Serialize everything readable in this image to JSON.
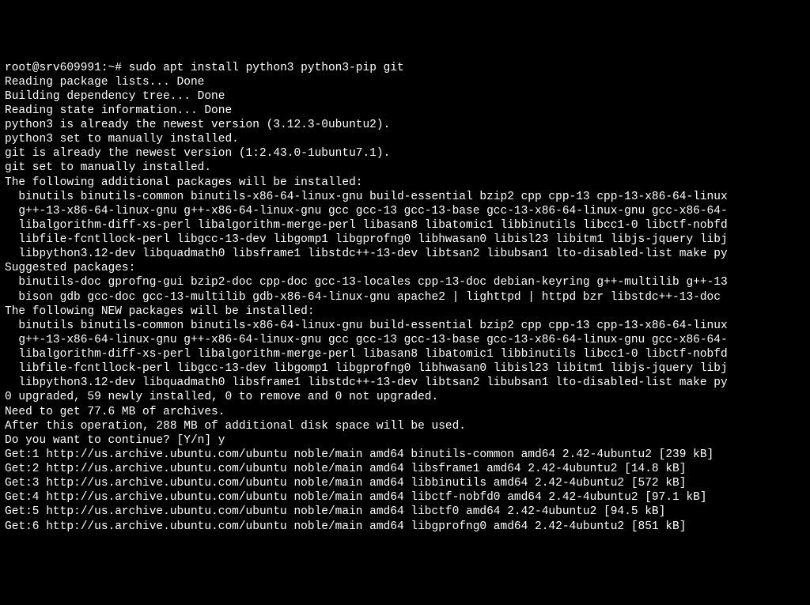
{
  "prompt": {
    "user_host": "root@srv609991",
    "cwd": "~",
    "symbol": "#",
    "command": "sudo apt install python3 python3-pip git"
  },
  "lines": [
    "Reading package lists... Done",
    "Building dependency tree... Done",
    "Reading state information... Done",
    "python3 is already the newest version (3.12.3-0ubuntu2).",
    "python3 set to manually installed.",
    "git is already the newest version (1:2.43.0-1ubuntu7.1).",
    "git set to manually installed.",
    "The following additional packages will be installed:",
    "  binutils binutils-common binutils-x86-64-linux-gnu build-essential bzip2 cpp cpp-13 cpp-13-x86-64-linux",
    "  g++-13-x86-64-linux-gnu g++-x86-64-linux-gnu gcc gcc-13 gcc-13-base gcc-13-x86-64-linux-gnu gcc-x86-64-",
    "  libalgorithm-diff-xs-perl libalgorithm-merge-perl libasan8 libatomic1 libbinutils libcc1-0 libctf-nobfd",
    "  libfile-fcntllock-perl libgcc-13-dev libgomp1 libgprofng0 libhwasan0 libisl23 libitm1 libjs-jquery libj",
    "  libpython3.12-dev libquadmath0 libsframe1 libstdc++-13-dev libtsan2 libubsan1 lto-disabled-list make py",
    "Suggested packages:",
    "  binutils-doc gprofng-gui bzip2-doc cpp-doc gcc-13-locales cpp-13-doc debian-keyring g++-multilib g++-13",
    "  bison gdb gcc-doc gcc-13-multilib gdb-x86-64-linux-gnu apache2 | lighttpd | httpd bzr libstdc++-13-doc ",
    "The following NEW packages will be installed:",
    "  binutils binutils-common binutils-x86-64-linux-gnu build-essential bzip2 cpp cpp-13 cpp-13-x86-64-linux",
    "  g++-13-x86-64-linux-gnu g++-x86-64-linux-gnu gcc gcc-13 gcc-13-base gcc-13-x86-64-linux-gnu gcc-x86-64-",
    "  libalgorithm-diff-xs-perl libalgorithm-merge-perl libasan8 libatomic1 libbinutils libcc1-0 libctf-nobfd",
    "  libfile-fcntllock-perl libgcc-13-dev libgomp1 libgprofng0 libhwasan0 libisl23 libitm1 libjs-jquery libj",
    "  libpython3.12-dev libquadmath0 libsframe1 libstdc++-13-dev libtsan2 libubsan1 lto-disabled-list make py",
    "0 upgraded, 59 newly installed, 0 to remove and 0 not upgraded.",
    "Need to get 77.6 MB of archives.",
    "After this operation, 288 MB of additional disk space will be used.",
    "Do you want to continue? [Y/n] y",
    "Get:1 http://us.archive.ubuntu.com/ubuntu noble/main amd64 binutils-common amd64 2.42-4ubuntu2 [239 kB]",
    "Get:2 http://us.archive.ubuntu.com/ubuntu noble/main amd64 libsframe1 amd64 2.42-4ubuntu2 [14.8 kB]",
    "Get:3 http://us.archive.ubuntu.com/ubuntu noble/main amd64 libbinutils amd64 2.42-4ubuntu2 [572 kB]",
    "Get:4 http://us.archive.ubuntu.com/ubuntu noble/main amd64 libctf-nobfd0 amd64 2.42-4ubuntu2 [97.1 kB]",
    "Get:5 http://us.archive.ubuntu.com/ubuntu noble/main amd64 libctf0 amd64 2.42-4ubuntu2 [94.5 kB]",
    "Get:6 http://us.archive.ubuntu.com/ubuntu noble/main amd64 libgprofng0 amd64 2.42-4ubuntu2 [851 kB]"
  ]
}
